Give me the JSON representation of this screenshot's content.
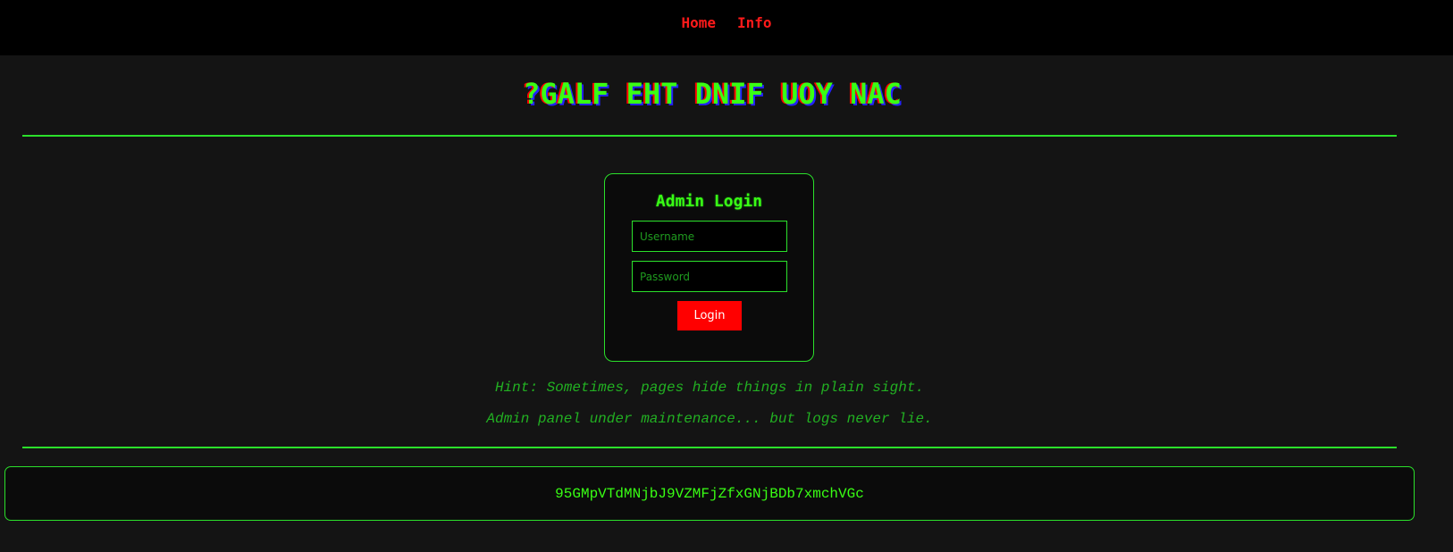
{
  "nav": {
    "items": [
      {
        "label": "Home"
      },
      {
        "label": "Info"
      }
    ]
  },
  "title": "?GALF EHT DNIF UOY NAC",
  "login": {
    "heading": "Admin Login",
    "username_placeholder": "Username",
    "password_placeholder": "Password",
    "button_label": "Login"
  },
  "hints": [
    "Hint: Sometimes, pages hide things in plain sight.",
    "Admin panel under maintenance... but logs never lie."
  ],
  "encoded_string": "95GMpVTdMNjbJ9VZMFjZfxGNjBDb7xmchVGc",
  "colors": {
    "background": "#141414",
    "nav_background": "#000000",
    "nav_link": "#ff1a1a",
    "accent_green": "#2be02b",
    "button_red": "#ff0000"
  }
}
